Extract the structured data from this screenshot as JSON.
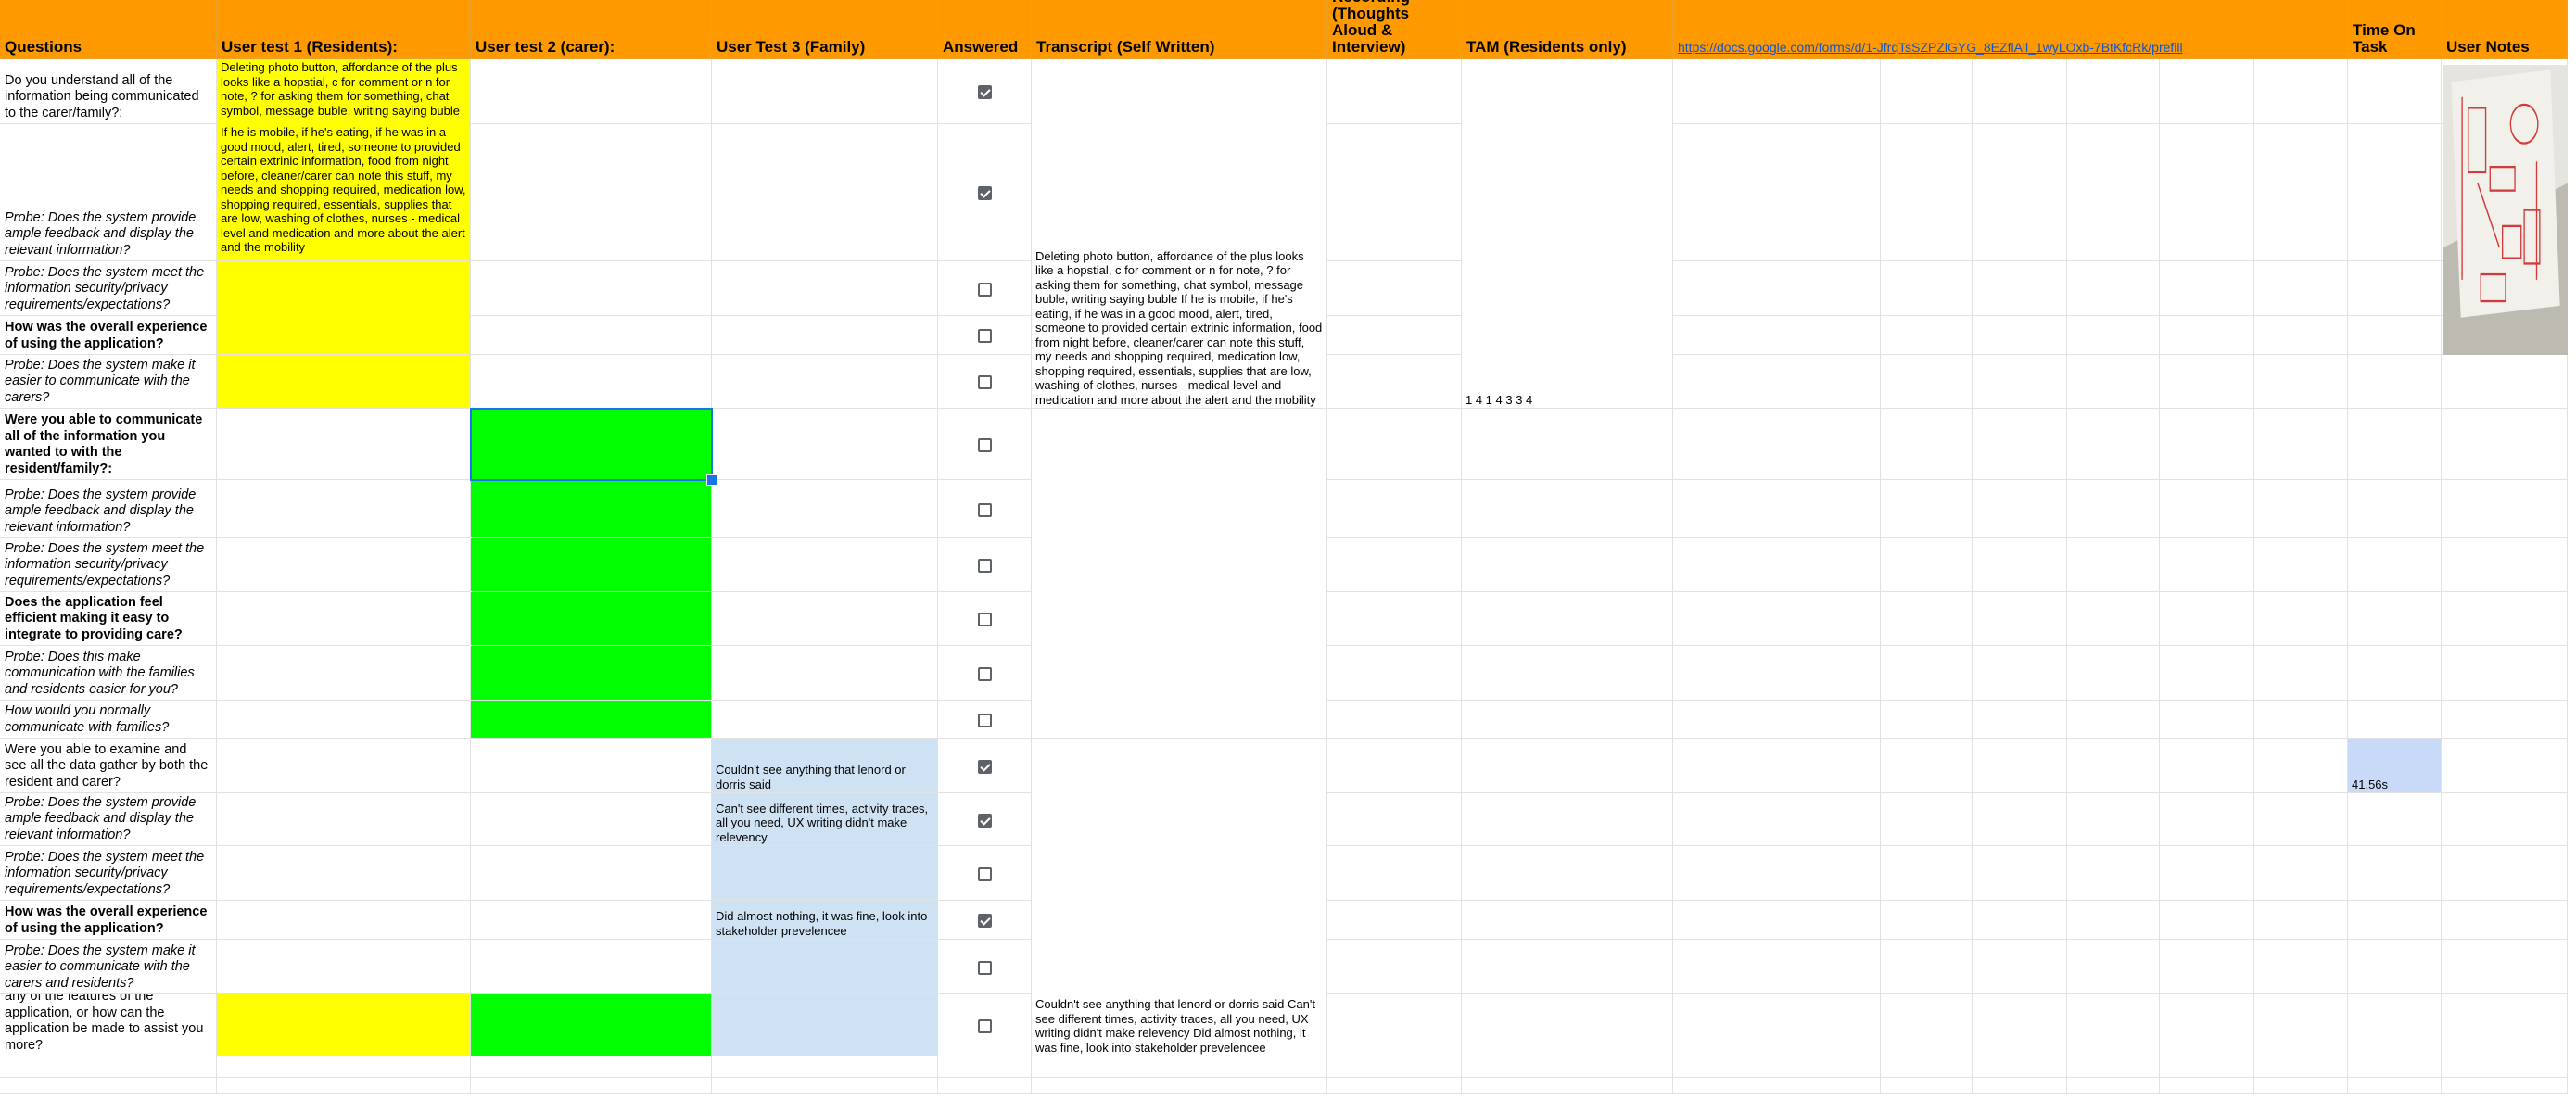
{
  "headers": {
    "questions": "Questions",
    "user1": "User test 1 (Residents):",
    "user2": "User test 2 (carer):",
    "user3": "User Test 3 (Family)",
    "answered": "Answered",
    "transcript": "Transcript (Self Written)",
    "recording": "Recording (Thoughts Aloud & Interview)",
    "tam": "TAM (Residents only)",
    "link": "https://docs.google.com/forms/d/1-JfrqTsSZPZlGYG_8EZflAll_1wyLOxb-7BtKfcRk/prefill",
    "time": "Time On Task",
    "notes": "User Notes"
  },
  "questions": [
    "Do you understand all of the information being communicated to the carer/family?:",
    "Probe: Does the system provide ample feedback and display the relevant information?",
    "Probe: Does the system meet the information security/privacy requirements/expectations?",
    "How was the overall experience of using the application?",
    "Probe: Does the system make it easier to communicate with the carers?",
    "Were you able to communicate all of the information you wanted to with the resident/family?:",
    "Probe: Does the system provide ample feedback and display the relevant information?",
    "Probe: Does the system meet the information security/privacy requirements/expectations?",
    "Does the application feel efficient making it easy to integrate to providing care?",
    "Probe: Does this make communication with the families and residents easier for you?",
    "How would you normally communicate with families?",
    "Were you able to examine and see all the data gather by both the resident and carer?",
    "Probe: Does the system provide ample feedback and display the relevant information?",
    "Probe: Does the system meet the information security/privacy requirements/expectations?",
    "How was the overall experience of using the application?",
    "Probe: Does the system make it easier to communicate with the carers and residents?",
    "CODESIGN: Would you change any of the features of the application, or how can the application be made to assist you more?"
  ],
  "answered": [
    true,
    true,
    false,
    false,
    false,
    false,
    false,
    false,
    false,
    false,
    false,
    true,
    true,
    false,
    true,
    false,
    false
  ],
  "user1": {
    "r0": "Deleting photo button, affordance of the plus looks like a hopstial, c for comment or n for note, ? for asking them for something, chat symbol, message buble, writing saying buble",
    "r1": "If he is mobile, if he's eating, if he was in a good mood, alert, tired, someone to provided certain extrinic information, food from night before, cleaner/carer can note this stuff, my needs and shopping required, medication low, shopping required, essentials, supplies that are low, washing of clothes, nurses - medical level and medication and more about the alert and the mobility"
  },
  "user3": {
    "r11": "Couldn't see anything that lenord or dorris said",
    "r12": "Can't see different times, activity traces, all you need, UX writing didn't make relevency",
    "r14": "Did almost nothing, it was fine, look into stakeholder prevelencee"
  },
  "transcript": {
    "block1": "Deleting photo button, affordance of the plus looks like a hopstial, c for comment or n for note, ? for asking them for something, chat symbol, message buble, writing saying buble If he is mobile, if he's eating, if he was in a good mood, alert, tired, someone to provided certain extrinic information, food from night before, cleaner/carer can note this stuff, my needs and shopping required, medication low, shopping required, essentials, supplies that are low, washing of clothes, nurses - medical level and medication and more about the alert and the mobility",
    "block3": "Couldn't see anything that lenord or dorris said Can't see different times, activity traces, all you need, UX writing didn't make relevency   Did almost nothing, it was fine, look into stakeholder prevelencee"
  },
  "tam": "1 4 1 4 3 3 4",
  "time_on_task": "41.56s",
  "colors": {
    "header": "#ff9900",
    "resident_fill": "#ffff00",
    "carer_fill": "#00ff00",
    "family_fill": "#cfe2f3",
    "time_fill": "#c9daf8",
    "selection": "#1a73e8"
  },
  "icons": {
    "checkbox": "checkbox-icon",
    "selection_handle": "fill-handle-icon",
    "notes_photo": "sketch-photo-image"
  }
}
